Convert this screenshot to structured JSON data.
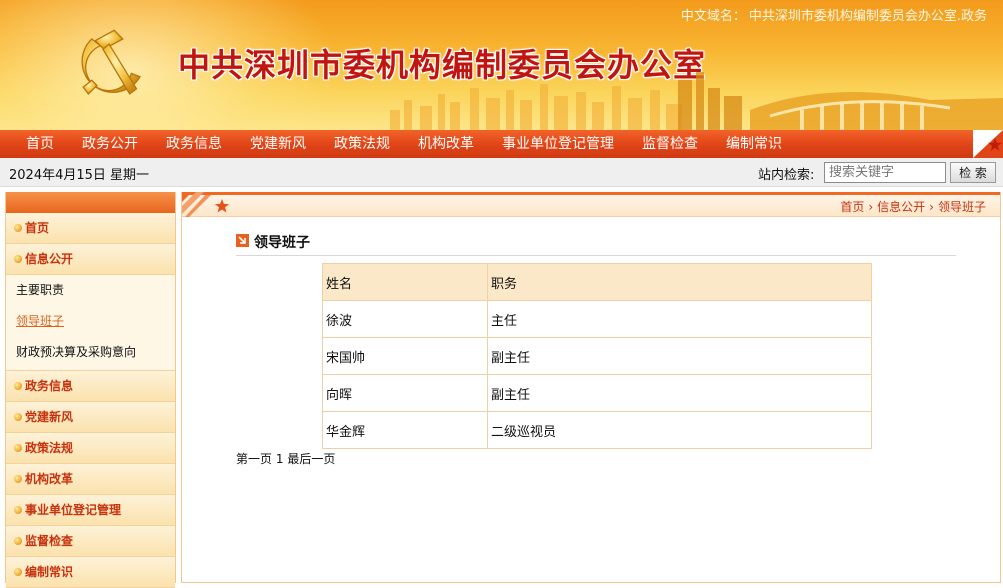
{
  "banner": {
    "domain_label": "中文域名：",
    "domain_value": "中共深圳市委机构编制委员会办公室.政务",
    "site_title": "中共深圳市委机构编制委员会办公室"
  },
  "nav": {
    "items": [
      "首页",
      "政务公开",
      "政务信息",
      "党建新风",
      "政策法规",
      "机构改革",
      "事业单位登记管理",
      "监督检查",
      "编制常识"
    ]
  },
  "infobar": {
    "date": "2024年4月15日 星期一",
    "search_label": "站内检索:",
    "search_placeholder": "搜索关键字",
    "search_button": "检 索"
  },
  "sidebar": {
    "items": [
      {
        "label": "首页"
      },
      {
        "label": "信息公开"
      }
    ],
    "subitems": [
      {
        "label": "主要职责"
      },
      {
        "label": "领导班子"
      },
      {
        "label": "财政预决算及采购意向"
      }
    ],
    "more_items": [
      {
        "label": "政务信息"
      },
      {
        "label": "党建新风"
      },
      {
        "label": "政策法规"
      },
      {
        "label": "机构改革"
      },
      {
        "label": "事业单位登记管理"
      },
      {
        "label": "监督检查"
      },
      {
        "label": "编制常识"
      }
    ]
  },
  "main": {
    "breadcrumb": [
      "首页",
      "信息公开",
      "领导班子"
    ],
    "breadcrumb_sep": "›",
    "section_title": "领导班子",
    "table": {
      "headers": [
        "姓名",
        "职务"
      ],
      "rows": [
        [
          "徐波",
          "主任"
        ],
        [
          "宋国帅",
          "副主任"
        ],
        [
          "向晖",
          "副主任"
        ],
        [
          "华金辉",
          "二级巡视员"
        ]
      ]
    },
    "pager": {
      "first": "第一页",
      "page": "1",
      "last": "最后一页"
    }
  },
  "colors": {
    "nav_red": "#e04417",
    "accent_orange": "#f06a24",
    "title_red": "#c01510",
    "link_orange": "#d9621c"
  }
}
